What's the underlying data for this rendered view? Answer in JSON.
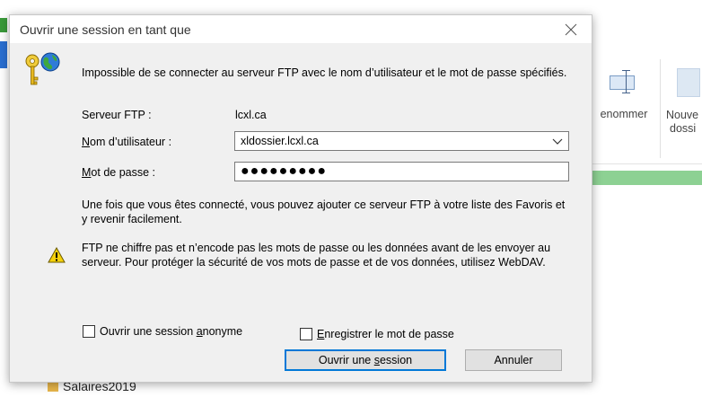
{
  "background": {
    "ribbon": {
      "rename_label": "enommer",
      "new_folder_label_line1": "Nouve",
      "new_folder_label_line2": "dossi"
    },
    "sidebar_item_label": "Salaires2019"
  },
  "dialog": {
    "title": "Ouvrir une session en tant que",
    "error_message": "Impossible de se connecter au serveur FTP avec le nom d’utilisateur et le mot de passe spécifiés.",
    "server_label": "Serveur FTP :",
    "server_value": "lcxl.ca",
    "username_label": {
      "underlined": "N",
      "rest": "om d’utilisateur :"
    },
    "username_value": "xldossier.lcxl.ca",
    "password_label": {
      "underlined": "M",
      "rest": "ot de passe :"
    },
    "password_mask": "●●●●●●●●●",
    "info_text": "Une fois que vous êtes connecté, vous pouvez ajouter ce serveur FTP à votre liste des Favoris et y revenir facilement.",
    "warning_text": "FTP ne chiffre pas et n’encode pas les mots de passe ou les données avant de les envoyer au serveur. Pour protéger la sécurité de vos mots de passe et de vos données, utilisez WebDAV.",
    "anon_checkbox": {
      "prefix": "Ouvrir une session ",
      "underlined": "a",
      "suffix": "nonyme"
    },
    "save_checkbox": {
      "underlined": "E",
      "rest": "nregistrer le mot de passe"
    },
    "login_button": {
      "prefix": "Ouvrir une ",
      "underlined": "s",
      "suffix": "ession"
    },
    "cancel_button": "Annuler"
  }
}
